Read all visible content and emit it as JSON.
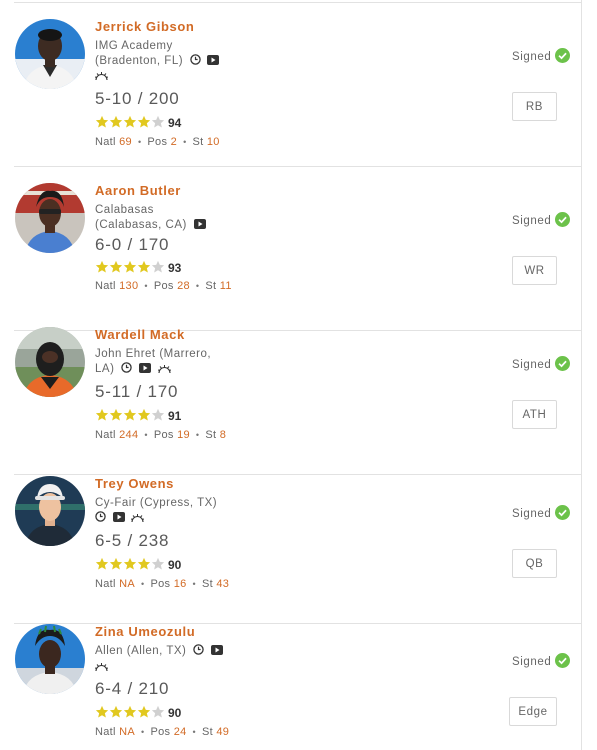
{
  "colors": {
    "accent": "#d26b26",
    "star": "#e1c81f",
    "star_empty": "#d0d0d0",
    "signed": "#6cc24a"
  },
  "players": [
    {
      "name": "Jerrick Gibson",
      "school_line1": "IMG Academy",
      "school_line2": "(Bradenton, FL)",
      "icons": [
        "clock-icon",
        "video-icon",
        "sun-rays-icon"
      ],
      "ht_wt": "5-10 / 200",
      "stars": 4,
      "rating": "94",
      "natl_label": "Natl",
      "natl": "69",
      "pos_label": "Pos",
      "pos_rank": "2",
      "st_label": "St",
      "st": "10",
      "status": "Signed",
      "position": "RB"
    },
    {
      "name": "Aaron Butler",
      "school_line1": "Calabasas",
      "school_line2": "(Calabasas, CA)",
      "icons": [
        "video-icon"
      ],
      "ht_wt": "6-0 / 170",
      "stars": 4,
      "rating": "93",
      "natl_label": "Natl",
      "natl": "130",
      "pos_label": "Pos",
      "pos_rank": "28",
      "st_label": "St",
      "st": "11",
      "status": "Signed",
      "position": "WR"
    },
    {
      "name": "Wardell Mack",
      "school_line1": "John Ehret (Marrero,",
      "school_line2": "LA)",
      "icons": [
        "clock-icon",
        "video-icon",
        "sun-rays-icon"
      ],
      "ht_wt": "5-11 / 170",
      "stars": 4,
      "rating": "91",
      "natl_label": "Natl",
      "natl": "244",
      "pos_label": "Pos",
      "pos_rank": "19",
      "st_label": "St",
      "st": "8",
      "status": "Signed",
      "position": "ATH"
    },
    {
      "name": "Trey Owens",
      "school_line1": "Cy-Fair (Cypress, TX)",
      "school_line2": "",
      "icons": [
        "clock-icon",
        "video-icon",
        "sun-rays-icon"
      ],
      "ht_wt": "6-5 / 238",
      "stars": 4,
      "rating": "90",
      "natl_label": "Natl",
      "natl": "NA",
      "pos_label": "Pos",
      "pos_rank": "16",
      "st_label": "St",
      "st": "43",
      "status": "Signed",
      "position": "QB"
    },
    {
      "name": "Zina Umeozulu",
      "school_line1": "Allen (Allen, TX)",
      "school_line2": "",
      "icons": [
        "clock-icon",
        "video-icon",
        "sun-rays-icon"
      ],
      "ht_wt": "6-4 / 210",
      "stars": 4,
      "rating": "90",
      "natl_label": "Natl",
      "natl": "NA",
      "pos_label": "Pos",
      "pos_rank": "24",
      "st_label": "St",
      "st": "49",
      "status": "Signed",
      "position": "Edge"
    }
  ]
}
